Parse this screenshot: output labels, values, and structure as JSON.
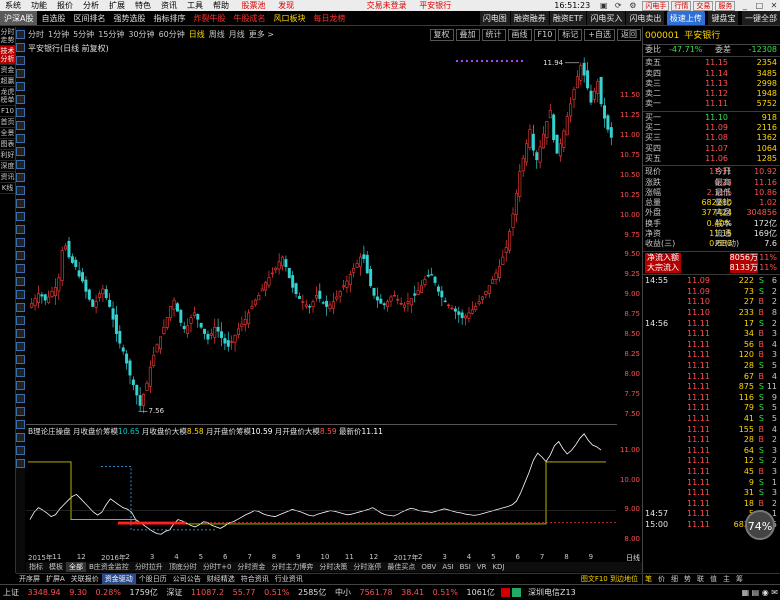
{
  "menu": {
    "items": [
      "系统",
      "功能",
      "报价",
      "分析",
      "扩展",
      "特色",
      "资讯",
      "工具",
      "帮助"
    ],
    "account": "股票池",
    "trial": "发现",
    "center_status": "交易未登录",
    "center_stock": "平安银行",
    "clock": "16:51:23",
    "right_buttons": [
      "闪电手",
      "行情",
      "交易",
      "服务"
    ]
  },
  "toolbar": {
    "items": [
      "沪深A股",
      "自选股",
      "区间排名",
      "强势选股",
      "指标排序"
    ],
    "red_items": [
      "炸裂牛股",
      "牛股成名"
    ],
    "yellow_items": [
      "风口板块",
      "每日龙榜"
    ],
    "right_items": [
      "闪电图",
      "融资融券",
      "融资ETF",
      "闪电买入",
      "闪电卖出"
    ],
    "quick_label": "极速上传",
    "extra_items": [
      "键盘宝"
    ],
    "last": "一键全部"
  },
  "left_tabs": [
    "分时走势",
    "技术分析",
    "资金",
    "超赢",
    "龙虎榜单",
    "F10",
    "首页",
    "全景",
    "图表",
    "利好",
    "深度",
    "资讯",
    "K线"
  ],
  "left_tabs_selected": 1,
  "period_bar": {
    "items": [
      "分时",
      "1分钟",
      "5分钟",
      "15分钟",
      "30分钟",
      "60分钟",
      "日线",
      "周线",
      "月线",
      "更多 >"
    ],
    "selected": "日线",
    "right_buttons": [
      "复权",
      "叠加",
      "统计",
      "画线",
      "F10",
      "标记",
      "+自选",
      "返回"
    ]
  },
  "chart_info": {
    "title": "平安银行(日线 前复权)"
  },
  "price_axis": {
    "ticks": [
      "11.50",
      "11.25",
      "11.00",
      "10.75",
      "10.50",
      "10.25",
      "10.00",
      "9.75",
      "9.50",
      "9.25",
      "9.00",
      "8.75",
      "8.50",
      "8.25",
      "8.00",
      "7.75",
      "7.50"
    ],
    "highlight_high": "11.94",
    "highlight_low": "7.56"
  },
  "chart_data": {
    "type": "candlestick",
    "ylim": [
      7.4,
      12.0
    ],
    "annotations": {
      "high": "11.94",
      "low": "7.56"
    },
    "series_close": [
      8.9,
      8.96,
      9.02,
      8.99,
      8.94,
      8.98,
      9.05,
      9.1,
      9.22,
      9.56,
      9.62,
      9.48,
      9.41,
      9.36,
      9.24,
      9.18,
      9.05,
      8.95,
      8.86,
      8.92,
      9.02,
      9.08,
      8.97,
      8.86,
      8.7,
      8.52,
      8.4,
      8.3,
      8.15,
      8.0,
      7.88,
      7.75,
      7.62,
      7.76,
      7.9,
      8.1,
      8.25,
      8.38,
      8.48,
      8.6,
      8.72,
      8.86,
      8.94,
      8.8,
      8.66,
      8.58,
      8.62,
      8.72,
      8.78,
      8.7,
      8.6,
      8.52,
      8.45,
      8.52,
      8.6,
      8.55,
      8.47,
      8.4,
      8.36,
      8.42,
      8.5,
      8.58,
      8.64,
      8.7,
      8.78,
      8.86,
      8.94,
      9.0,
      9.08,
      9.16,
      9.22,
      9.28,
      9.34,
      9.42,
      9.48,
      9.36,
      9.22,
      9.1,
      9.02,
      8.96,
      8.92,
      8.88,
      8.86,
      8.92,
      9.0,
      8.96,
      8.9,
      8.86,
      8.88,
      8.92,
      8.98,
      9.05,
      9.12,
      9.18,
      9.26,
      9.34,
      9.4,
      9.48,
      9.46,
      9.28,
      9.12,
      9.0,
      8.94,
      8.9,
      8.88,
      8.92,
      8.98,
      9.0,
      8.95,
      8.9,
      8.88,
      8.92,
      8.96,
      9.0,
      9.06,
      9.12,
      9.2,
      9.24,
      9.26,
      9.16,
      9.05,
      8.98,
      8.92,
      8.88,
      8.84,
      8.8,
      8.76,
      8.72,
      8.74,
      8.78,
      8.82,
      8.86,
      8.92,
      8.98,
      9.05,
      9.12,
      9.2,
      9.28,
      9.36,
      9.48,
      9.6,
      9.8,
      10.02,
      10.28,
      10.55,
      10.72,
      10.9,
      11.08,
      10.82,
      10.7,
      10.86,
      11.02,
      11.18,
      11.32,
      10.95,
      10.78,
      10.9,
      11.06,
      11.24,
      11.4,
      11.58,
      11.74,
      11.88,
      11.76,
      11.6,
      11.42,
      11.56,
      11.68,
      11.4,
      11.22,
      11.08,
      10.98
    ]
  },
  "indicator": {
    "name": "B理论庄操盘",
    "items": [
      {
        "label": "月收盘价筹模",
        "value": "10.65",
        "color": "cy"
      },
      {
        "label": "月收盘价大模",
        "value": "8.58",
        "color": "cy2"
      },
      {
        "label": "月开盘价筹模",
        "value": "10.59",
        "color": "w"
      },
      {
        "label": "月开盘价大模",
        "value": "8.59",
        "color": "r"
      },
      {
        "label": "最新价",
        "value": "11.11",
        "color": "w"
      }
    ],
    "axis_ticks": [
      "11.00",
      "10.00",
      "9.00",
      "8.00"
    ],
    "line_series": [
      8.7,
      8.95,
      9.1,
      9.02,
      8.92,
      8.8,
      8.86,
      9.05,
      9.2,
      9.35,
      9.48,
      9.55,
      9.4,
      9.25,
      9.1,
      8.95,
      8.85,
      8.95,
      9.2,
      9.4,
      9.3,
      9.2,
      9.1,
      9.05,
      8.95,
      8.7,
      8.6,
      8.5,
      8.4,
      8.3,
      8.22,
      8.2,
      8.3,
      8.35,
      8.55,
      8.7,
      8.65,
      8.58,
      8.5,
      8.45,
      8.52,
      8.62,
      8.6,
      8.5,
      8.45,
      8.4,
      8.48,
      8.58,
      8.62,
      8.7,
      8.78,
      8.86,
      8.92,
      9.0,
      8.98,
      8.9,
      8.85,
      8.82,
      8.8,
      8.86,
      8.92,
      8.98,
      9.04,
      9.0,
      8.96,
      8.9,
      8.84,
      8.82,
      8.88,
      8.92,
      8.96,
      9.0,
      8.98,
      8.94,
      8.9,
      8.86,
      8.88,
      8.92,
      8.96,
      9.0,
      9.04,
      9.1,
      9.02,
      8.92,
      8.86,
      8.84,
      8.82,
      8.88,
      8.96,
      9.02,
      9.08,
      9.05,
      9.0,
      8.98,
      8.96,
      8.94,
      8.98,
      9.02,
      9.06,
      9.02,
      8.98,
      8.94,
      8.92,
      8.88,
      8.86,
      8.84,
      8.86,
      8.9,
      8.94,
      8.98,
      9.02,
      9.06,
      9.1,
      9.14,
      9.2,
      9.32,
      9.6,
      9.95,
      10.3,
      10.7,
      10.95,
      10.82,
      10.66,
      10.88,
      11.2,
      11.34,
      11.1,
      10.92,
      11.04,
      11.22,
      11.45,
      11.6,
      11.38,
      11.22,
      11.16,
      11.05
    ]
  },
  "date_bar": {
    "labels": [
      "2015年",
      "11",
      "12",
      "2016年",
      "2",
      "3",
      "4",
      "5",
      "6",
      "7",
      "8",
      "9",
      "10",
      "11",
      "12",
      "2017年",
      "2",
      "3",
      "4",
      "5",
      "6",
      "7",
      "8",
      "9"
    ],
    "right": "日线"
  },
  "indicator_tabs": [
    "指标",
    "模板",
    "全部",
    "B庄资金监控",
    "分时拉升",
    "顶底分时",
    "分时T+0",
    "分时资金",
    "分时主力博弈",
    "分时决策",
    "分时涨停",
    "最佳买点",
    "OBV",
    "ASI",
    "BSI",
    "VR",
    "KDJ"
  ],
  "indicator_tabs_selected": 2,
  "sub_tabs": [
    "开序屏",
    "扩屏A",
    "关联报价",
    "资金驱动",
    "个股日历",
    "公司公告",
    "财经精选",
    "符合资讯",
    "行业资讯"
  ],
  "sub_tabs_selected": 3,
  "sub_tabs_right": "图文F10",
  "sub_tabs_right2": "到边地位",
  "quote": {
    "code": "000001",
    "name": "平安银行",
    "weibi_label": "委比",
    "weibi": "-47.71%",
    "weicha_label": "委差",
    "weicha": "-12308",
    "asks": [
      {
        "label": "卖五",
        "price": "11.15",
        "vol": "2354"
      },
      {
        "label": "卖四",
        "price": "11.14",
        "vol": "3485"
      },
      {
        "label": "卖三",
        "price": "11.13",
        "vol": "2998"
      },
      {
        "label": "卖二",
        "price": "11.12",
        "vol": "1948"
      },
      {
        "label": "卖一",
        "price": "11.11",
        "vol": "5752"
      }
    ],
    "bids": [
      {
        "label": "买一",
        "price": "11.10",
        "vol": "918"
      },
      {
        "label": "买二",
        "price": "11.09",
        "vol": "2116"
      },
      {
        "label": "买三",
        "price": "11.08",
        "vol": "1362"
      },
      {
        "label": "买四",
        "price": "11.07",
        "vol": "1064"
      },
      {
        "label": "买五",
        "price": "11.06",
        "vol": "1285"
      }
    ],
    "stats": [
      {
        "l": "现价",
        "v": "11.11",
        "l2": "今开",
        "v2": "10.92"
      },
      {
        "l": "涨跌",
        "v": "0.23",
        "l2": "最高",
        "v2": "11.16"
      },
      {
        "l": "涨幅",
        "v": "2.11%",
        "l2": "最低",
        "v2": "10.86"
      },
      {
        "l": "总量",
        "v": "682280",
        "l2": "量比",
        "v2": "1.02"
      },
      {
        "l": "外盘",
        "v": "377424",
        "l2": "内盘",
        "v2": "304856"
      },
      {
        "l": "换手",
        "v": "0.40%",
        "l2": "股本",
        "v2": "172亿"
      },
      {
        "l": "净资",
        "v": "11.15",
        "l2": "流通",
        "v2": "169亿"
      },
      {
        "l": "收益(三)",
        "v": "0.680",
        "l2": "PE(动)",
        "v2": "7.6"
      }
    ],
    "flows": [
      {
        "l": "净流入额",
        "v": "8056万",
        "p": "11%"
      },
      {
        "l": "大宗流入",
        "v": "8133万",
        "p": "11%"
      }
    ],
    "ticks": [
      {
        "t": "14:55",
        "p": "11.09",
        "v": "222",
        "d": "S",
        "n": "6"
      },
      {
        "t": "",
        "p": "11.09",
        "v": "73",
        "d": "S",
        "n": "2"
      },
      {
        "t": "",
        "p": "11.10",
        "v": "27",
        "d": "B",
        "n": "2"
      },
      {
        "t": "",
        "p": "11.10",
        "v": "233",
        "d": "B",
        "n": "8"
      },
      {
        "t": "14:56",
        "p": "11.11",
        "v": "17",
        "d": "S",
        "n": "2"
      },
      {
        "t": "",
        "p": "11.11",
        "v": "34",
        "d": "B",
        "n": "3"
      },
      {
        "t": "",
        "p": "11.11",
        "v": "56",
        "d": "B",
        "n": "4"
      },
      {
        "t": "",
        "p": "11.11",
        "v": "120",
        "d": "B",
        "n": "3"
      },
      {
        "t": "",
        "p": "11.11",
        "v": "28",
        "d": "S",
        "n": "5"
      },
      {
        "t": "",
        "p": "11.11",
        "v": "67",
        "d": "B",
        "n": "4"
      },
      {
        "t": "",
        "p": "11.11",
        "v": "875",
        "d": "S",
        "n": "11"
      },
      {
        "t": "",
        "p": "11.11",
        "v": "116",
        "d": "S",
        "n": "9"
      },
      {
        "t": "",
        "p": "11.11",
        "v": "79",
        "d": "S",
        "n": "5"
      },
      {
        "t": "",
        "p": "11.11",
        "v": "41",
        "d": "S",
        "n": "5"
      },
      {
        "t": "",
        "p": "11.11",
        "v": "155",
        "d": "B",
        "n": "4"
      },
      {
        "t": "",
        "p": "11.11",
        "v": "28",
        "d": "B",
        "n": "2"
      },
      {
        "t": "",
        "p": "11.11",
        "v": "64",
        "d": "S",
        "n": "3"
      },
      {
        "t": "",
        "p": "11.11",
        "v": "12",
        "d": "S",
        "n": "2"
      },
      {
        "t": "",
        "p": "11.11",
        "v": "45",
        "d": "B",
        "n": "3"
      },
      {
        "t": "",
        "p": "11.11",
        "v": "9",
        "d": "S",
        "n": "1"
      },
      {
        "t": "",
        "p": "11.11",
        "v": "31",
        "d": "S",
        "n": "3"
      },
      {
        "t": "",
        "p": "11.11",
        "v": "18",
        "d": "B",
        "n": "2"
      },
      {
        "t": "14:57",
        "p": "11.11",
        "v": "5",
        "d": "S",
        "n": "1"
      },
      {
        "t": "15:00",
        "p": "11.11",
        "v": "6830",
        "d": "S",
        "n": "195"
      }
    ],
    "bottom_tabs": [
      "笔",
      "价",
      "细",
      "势",
      "联",
      "值",
      "主",
      "筹"
    ],
    "bottom_selected": 0,
    "percent_circle": "74%"
  },
  "status": {
    "sh_label": "上证",
    "sh": "3348.94",
    "sh_chg": "9.30",
    "sh_pct": "0.28%",
    "sh_amt": "1759亿",
    "sz_label": "深证",
    "sz": "11087.2",
    "sz_chg": "55.77",
    "sz_pct": "0.51%",
    "sz_amt": "2585亿",
    "zx_label": "中小",
    "zx": "7561.78",
    "zx_chg": "38.41",
    "zx_pct": "0.51%",
    "zx_amt": "1061亿",
    "feed": "深圳电信Z13"
  }
}
